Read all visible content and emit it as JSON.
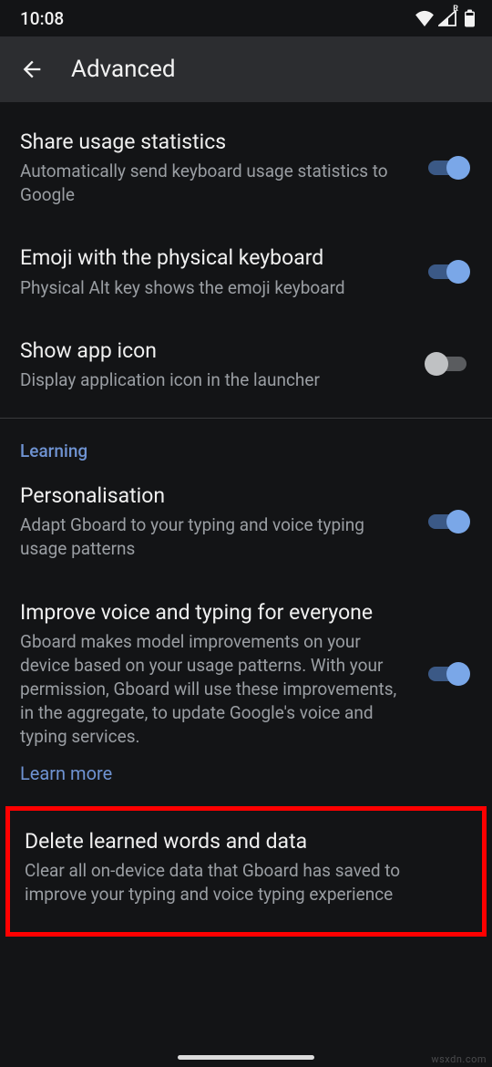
{
  "statusbar": {
    "time": "10:08",
    "signal_label": "R"
  },
  "appbar": {
    "title": "Advanced"
  },
  "items": {
    "share_stats": {
      "title": "Share usage statistics",
      "sub": "Automatically send keyboard usage statistics to Google",
      "on": true
    },
    "emoji_physical": {
      "title": "Emoji with the physical keyboard",
      "sub": "Physical Alt key shows the emoji keyboard",
      "on": true
    },
    "show_icon": {
      "title": "Show app icon",
      "sub": "Display application icon in the launcher",
      "on": false
    },
    "section_learning": "Learning",
    "personalisation": {
      "title": "Personalisation",
      "sub": "Adapt Gboard to your typing and voice typing usage patterns",
      "on": true
    },
    "improve_voice": {
      "title": "Improve voice and typing for everyone",
      "sub": "Gboard makes model improvements on your device based on your usage patterns. With your permission, Gboard will use these improvements, in the aggregate, to update Google's voice and typing services.",
      "on": true,
      "learn_more": "Learn more"
    },
    "delete_learned": {
      "title": "Delete learned words and data",
      "sub": "Clear all on-device data that Gboard has saved to improve your typing and voice typing experience"
    }
  },
  "watermark": "wsxdn.com"
}
